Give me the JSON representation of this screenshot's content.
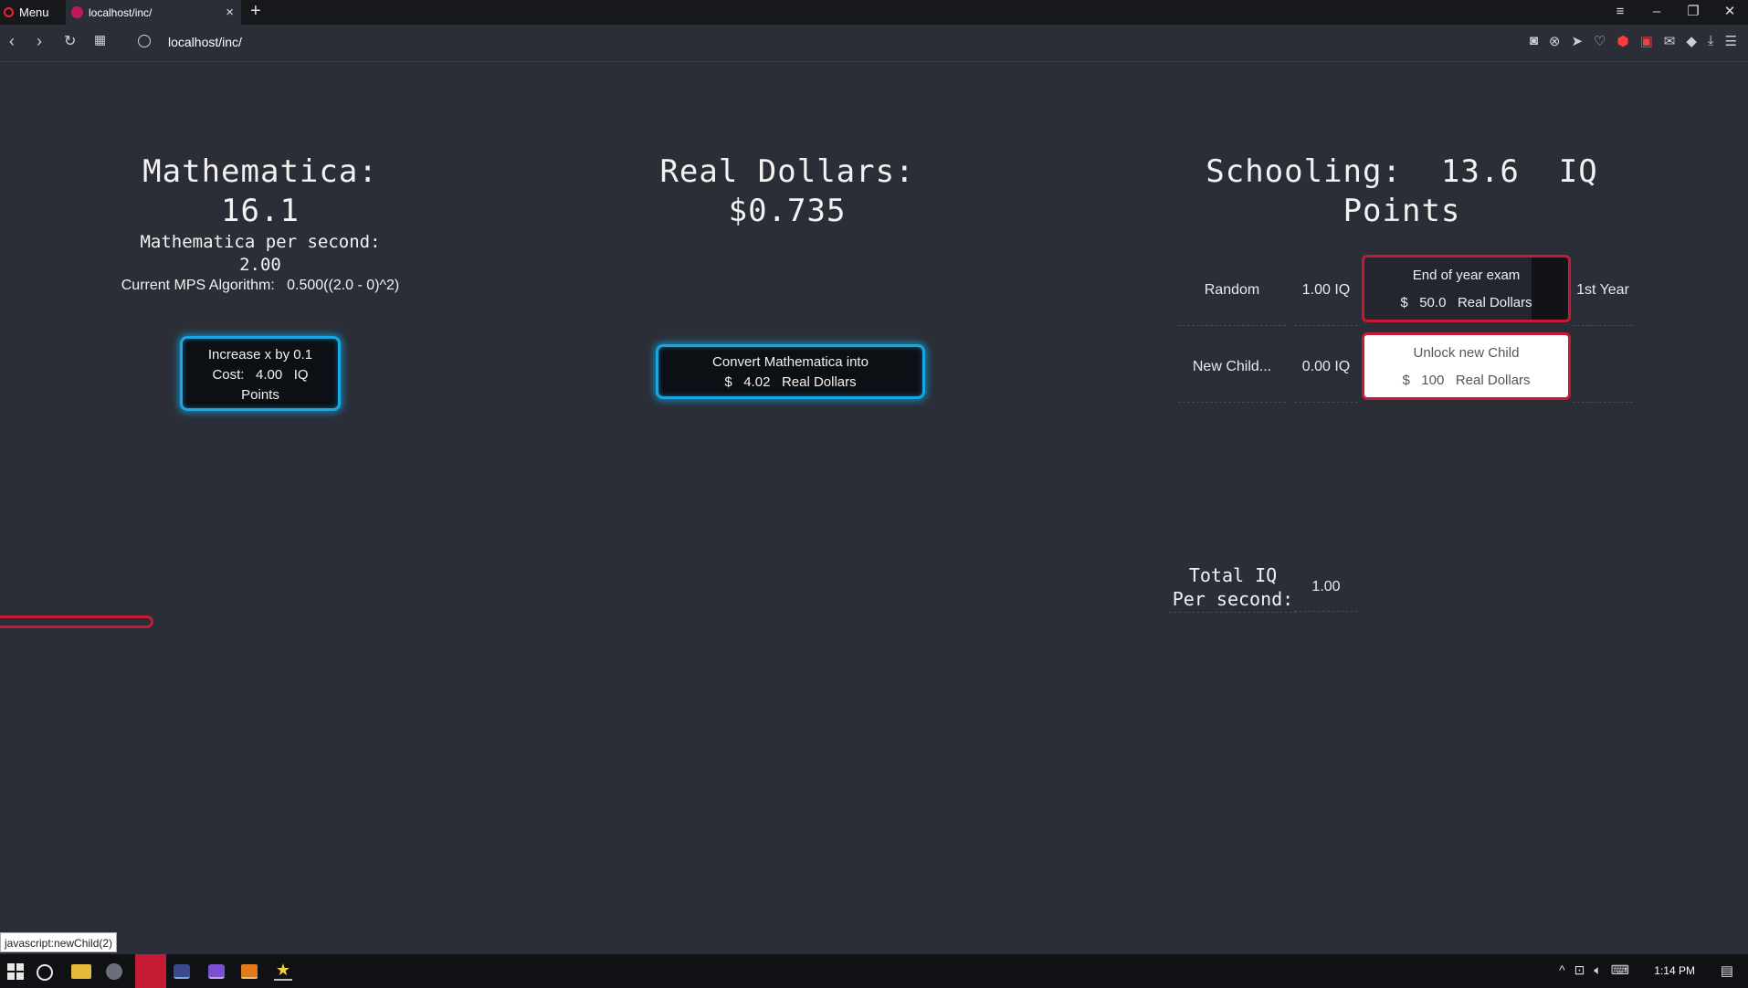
{
  "browser": {
    "menu_label": "Menu",
    "tab_title": "localhost/inc/",
    "url": "localhost/inc/",
    "status_text": "javascript:newChild(2)"
  },
  "mathematica": {
    "title": "Mathematica:",
    "value": "16.1",
    "mps_label": "Mathematica per second:",
    "mps_value": "2.00",
    "algorithm_label": "Current MPS Algorithm:",
    "algorithm_formula": "0.500((2.0 - 0)^2)",
    "increase_button": {
      "line1": "Increase x by 0.1",
      "cost_label": "Cost:",
      "cost_value": "4.00",
      "cost_unit": "IQ",
      "line3": "Points"
    }
  },
  "dollars": {
    "title": "Real Dollars:",
    "currency": "$",
    "value": "0.735",
    "convert_button": {
      "line1": "Convert Mathematica into",
      "currency": "$",
      "amount": "4.02",
      "unit": "Real Dollars"
    }
  },
  "schooling": {
    "title_prefix": "Schooling:",
    "title_value": "13.6",
    "title_unit": "IQ",
    "title_line2": "Points",
    "rows": [
      {
        "name": "Random",
        "rate": "1.00 IQ",
        "card_title": "End of year exam",
        "card_currency": "$",
        "card_amount": "50.0",
        "card_unit": "Real Dollars",
        "extra": "1st Year"
      },
      {
        "name": "New Child...",
        "rate": "0.00 IQ",
        "card_title": "Unlock new Child",
        "card_currency": "$",
        "card_amount": "100",
        "card_unit": "Real Dollars",
        "extra": ""
      }
    ],
    "exam_progress_fraction": 0.18,
    "total_label_line1": "Total IQ",
    "total_label_line2": "Per second:",
    "total_value": "1.00"
  },
  "taskbar": {
    "time": "1:14 PM"
  },
  "colors": {
    "background": "#2b2e37",
    "accent_blue": "#1aa7e0",
    "accent_red": "#c51a34"
  }
}
